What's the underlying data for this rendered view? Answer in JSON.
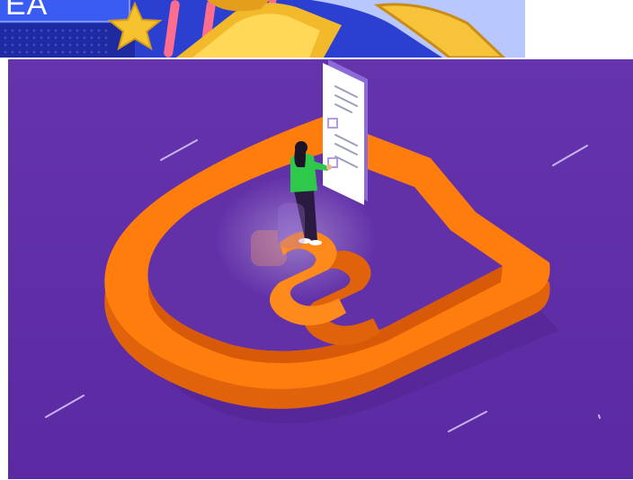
{
  "banner": {
    "text": "EA",
    "colors": {
      "button": "#3a5cf2",
      "star": "#f6c22e",
      "gold": "#f2b92a",
      "stripe_pink": "#ff6d8e",
      "panel_blue": "#2b3fd1"
    }
  },
  "illustration": {
    "subject": "person-standing-on-s-logo-shield",
    "colors": {
      "background": "#6231a8",
      "shield": "#ff7d0d",
      "shield_shadow": "#e0620a",
      "document": "#ffffff",
      "document_edge": "#8c6ad8",
      "person_top": "#2ec84a",
      "person_pants": "#2a1a40"
    }
  }
}
